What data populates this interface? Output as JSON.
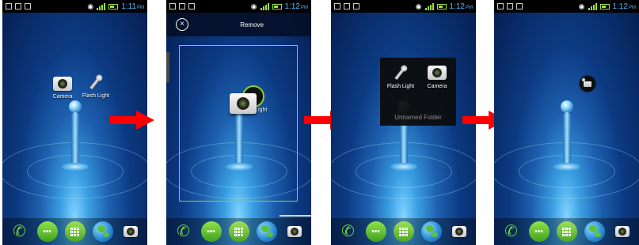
{
  "status_bar": {
    "time": "1:11",
    "time_suffix": "PM",
    "time_later": "1:12"
  },
  "apps": {
    "camera_label": "Camera",
    "flash_label": "Flash Light",
    "flash_partial": "ight"
  },
  "remove_bar": {
    "close_symbol": "×",
    "label": "Remove"
  },
  "folder": {
    "name": "Unnamed Folder"
  },
  "dock": {
    "items": [
      "phone-icon",
      "messaging-icon",
      "app-drawer-icon",
      "browser-icon",
      "camera-icon"
    ],
    "phone_glyph": "✆",
    "message_glyph": "•••"
  },
  "colors": {
    "arrow": "#ff0000",
    "dropzone_border": "#9bd21a",
    "clock": "#4fb8ff"
  }
}
